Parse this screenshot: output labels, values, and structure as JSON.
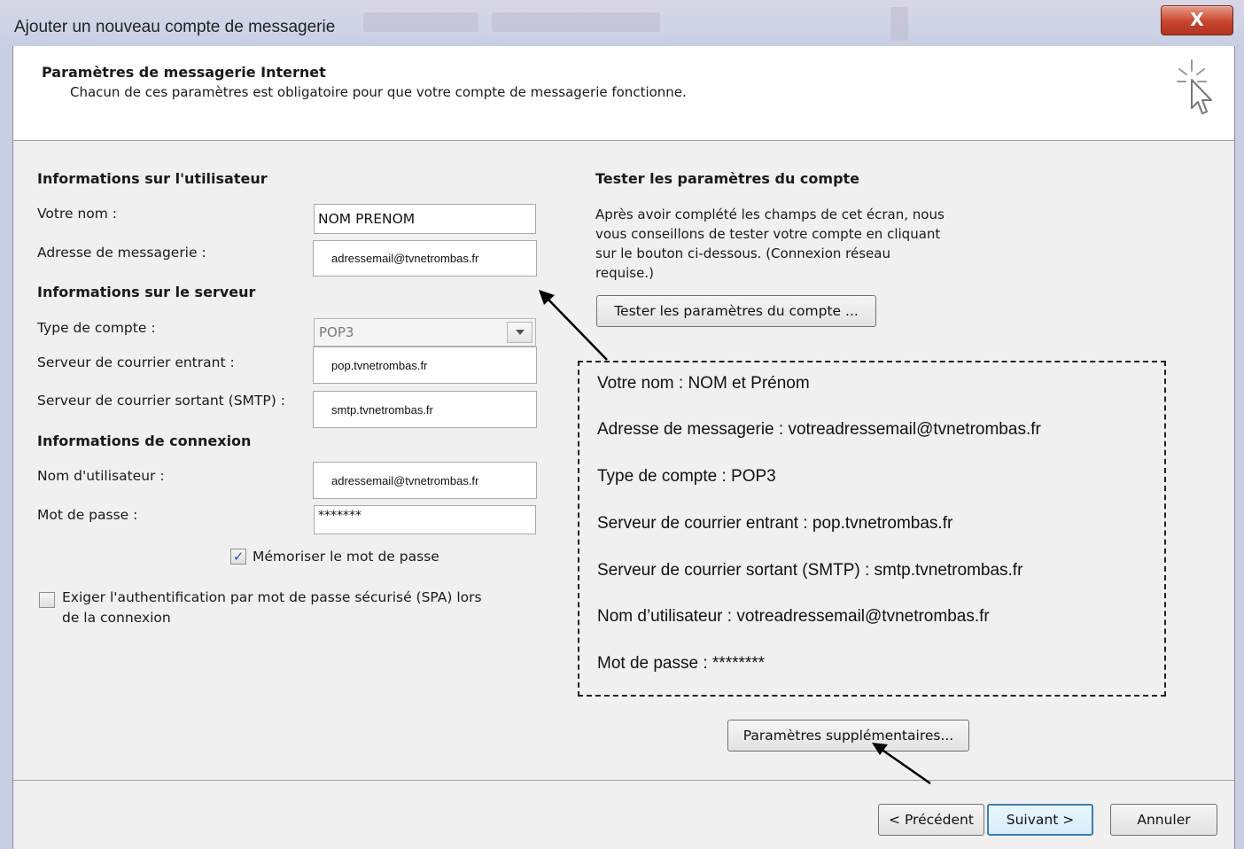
{
  "window": {
    "title": "Ajouter un nouveau compte de messagerie",
    "close_label": "X"
  },
  "header": {
    "title": "Paramètres de messagerie Internet",
    "subtitle": "Chacun de ces paramètres est obligatoire pour que votre compte de messagerie fonctionne."
  },
  "user_info": {
    "section": "Informations sur l'utilisateur",
    "name_label": "Votre nom :",
    "name_value": "NOM PRENOM",
    "email_label": "Adresse de messagerie :",
    "email_value": "adressemail@tvnetrombas.fr"
  },
  "server_info": {
    "section": "Informations sur le serveur",
    "account_type_label": "Type de compte :",
    "account_type_value": "POP3",
    "incoming_label": "Serveur de courrier entrant :",
    "incoming_value": "pop.tvnetrombas.fr",
    "outgoing_label": "Serveur de courrier sortant (SMTP) :",
    "outgoing_value": "smtp.tvnetrombas.fr"
  },
  "login_info": {
    "section": "Informations de connexion",
    "username_label": "Nom d'utilisateur :",
    "username_value": "adressemail@tvnetrombas.fr",
    "password_label": "Mot de passe :",
    "password_value": "*******",
    "remember_label": "Mémoriser le mot de passe",
    "remember_checked": true,
    "spa_label_line1": "Exiger l'authentification par mot de passe sécurisé (SPA) lors",
    "spa_label_line2": "de la connexion",
    "spa_checked": false
  },
  "test_settings": {
    "section": "Tester les paramètres du compte",
    "desc_line1": "Après avoir complété les champs de cet écran, nous",
    "desc_line2": "vous conseillons de tester votre compte en cliquant",
    "desc_line3": "sur le bouton ci-dessous. (Connexion réseau",
    "desc_line4": "requise.)",
    "test_button": "Tester les paramètres du compte ..."
  },
  "annotation": {
    "lines": [
      "Votre nom : NOM et Prénom",
      "Adresse de messagerie : votreadressemail@tvnetrombas.fr",
      "Type de compte : POP3",
      "Serveur de courrier entrant : pop.tvnetrombas.fr",
      "Serveur de courrier sortant (SMTP) : smtp.tvnetrombas.fr",
      "Nom d’utilisateur : votreadressemail@tvnetrombas.fr",
      "Mot de passe : ********"
    ]
  },
  "more_settings_button": "Paramètres supplémentaires...",
  "footer": {
    "back": "< Précédent",
    "next": "Suivant >",
    "cancel": "Annuler"
  },
  "colors": {
    "checkmark": "#2a52be",
    "default_button_border": "#3c7fb1",
    "close_button": "#c6452f"
  }
}
